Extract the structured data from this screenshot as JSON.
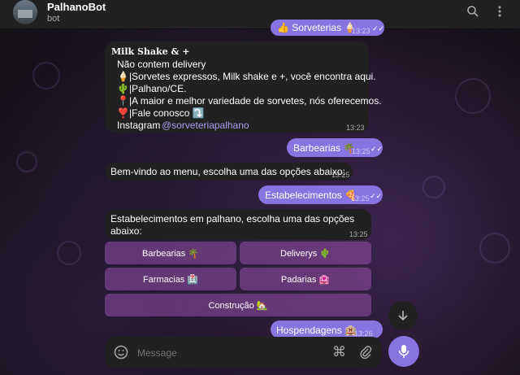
{
  "header": {
    "title": "PalhanoBot",
    "subtitle": "bot",
    "search_icon": "search-icon",
    "menu_icon": "more-vertical-icon"
  },
  "messages": {
    "top_out": {
      "text": "👍 Sorveterias 🍦",
      "time": "13:23"
    },
    "shop": {
      "name": "𝐌𝐢𝐥𝐤 𝐒𝐡𝐚𝐤𝐞 & +",
      "lines": [
        "Não contem delivery",
        "🍦|Sorvetes expressos, Milk shake e +, você encontra aqui.",
        "🌵|Palhano/CE.",
        "📍|A maior e melhor variedade de sorvetes, nós oferecemos.",
        "❣️|Fale conosco ⤵️"
      ],
      "instagram_label": "Instagram",
      "instagram_handle": "@sorveteriapalhano",
      "time": "13:23"
    },
    "barbearias_out": {
      "text": "Barbearias 🌴",
      "time": "13:25"
    },
    "welcome_in": {
      "text": "Bem-vindo ao menu, escolha uma das opções abaixo:",
      "time": "13:25"
    },
    "estab_out": {
      "text": "Estabelecimentos 🍕",
      "time": "13:25"
    },
    "estab_in": {
      "line1": "Estabelecimentos em palhano, escolha uma das opções",
      "line2": "abaixo:",
      "time": "13:25"
    },
    "keyboard": {
      "barbearias": "Barbearias 🌴",
      "deliverys": "Deliverys 🌵",
      "farmacias": "Farmacias 🏥",
      "padarias": "Padarias 🏩",
      "construcao": "Construção 🏡"
    },
    "hosp_out": {
      "text": "Hospendagens 🏨",
      "time": "13:26"
    }
  },
  "composer": {
    "placeholder": "Message",
    "emoji_icon": "smile-icon",
    "command_icon": "command-icon",
    "attach_icon": "paperclip-icon",
    "mic_icon": "microphone-icon",
    "scroll_icon": "arrow-down-icon"
  },
  "colors": {
    "accent": "#8774e1",
    "incoming_bubble": "#212121",
    "header_bg": "#212121",
    "keyboard_button": "#9650aa"
  }
}
